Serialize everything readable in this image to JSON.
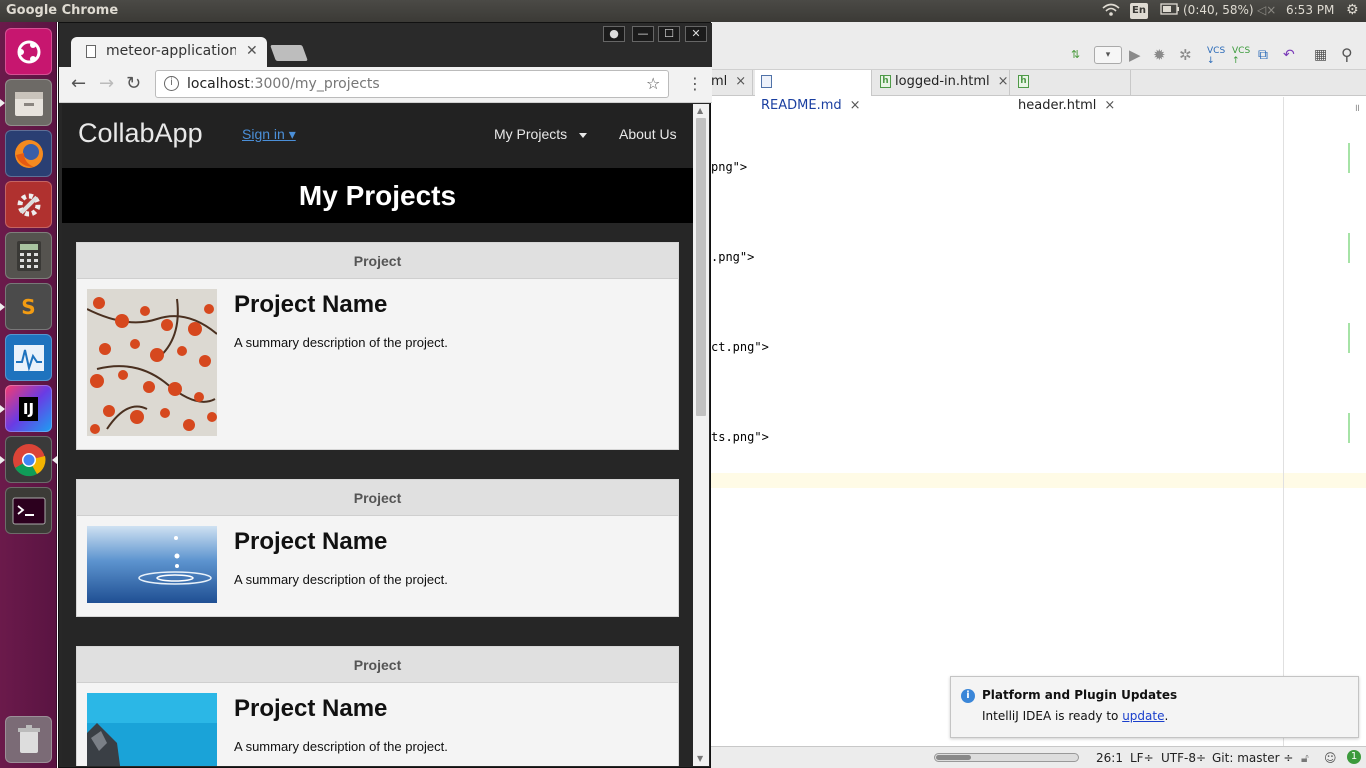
{
  "system": {
    "app_title": "Google Chrome",
    "keyboard": "En",
    "battery": "(0:40, 58%)",
    "clock": "6:53 PM"
  },
  "launcher": {
    "items": [
      "Ubuntu Dash",
      "Files",
      "Firefox",
      "System Settings",
      "Calculator",
      "Sublime Text",
      "System Monitor",
      "IntelliJ IDEA",
      "Google Chrome",
      "Terminal",
      "Trash"
    ]
  },
  "ide": {
    "tabs": [
      {
        "label": "ml",
        "kind": "html"
      },
      {
        "label": "README.md",
        "kind": "md"
      },
      {
        "label": "logged-in.html",
        "kind": "html"
      },
      {
        "label": "header.html",
        "kind": "html"
      }
    ],
    "code_lines": [
      "png\">",
      ".png\">",
      "ct.png\">",
      "ts.png\">"
    ],
    "status": {
      "position": "26:1",
      "line_sep": "LF÷",
      "encoding": "UTF-8÷",
      "vcs": "Git: master ÷",
      "events": "1"
    },
    "notification": {
      "title": "Platform and Plugin Updates",
      "body_prefix": "IntelliJ IDEA is ready to ",
      "link": "update",
      "body_suffix": "."
    }
  },
  "browser": {
    "tab_title": "meteor-application",
    "url_host": "localhost",
    "url_path": ":3000/my_projects"
  },
  "page": {
    "brand": "CollabApp",
    "sign_in": "Sign in ▾",
    "nav": [
      "My Projects",
      "About Us"
    ],
    "heading": "My Projects",
    "cards": [
      {
        "header": "Project",
        "name": "Project Name",
        "description": "A summary description of the project.",
        "image": "red blossoms"
      },
      {
        "header": "Project",
        "name": "Project Name",
        "description": "A summary description of the project.",
        "image": "water drop"
      },
      {
        "header": "Project",
        "name": "Project Name",
        "description": "A summary description of the project.",
        "image": "blue sky rocks"
      }
    ]
  },
  "colors": {
    "launcher_bg": "#5a1442",
    "navbar_bg": "#222222",
    "link_blue": "#4b8fd8"
  }
}
